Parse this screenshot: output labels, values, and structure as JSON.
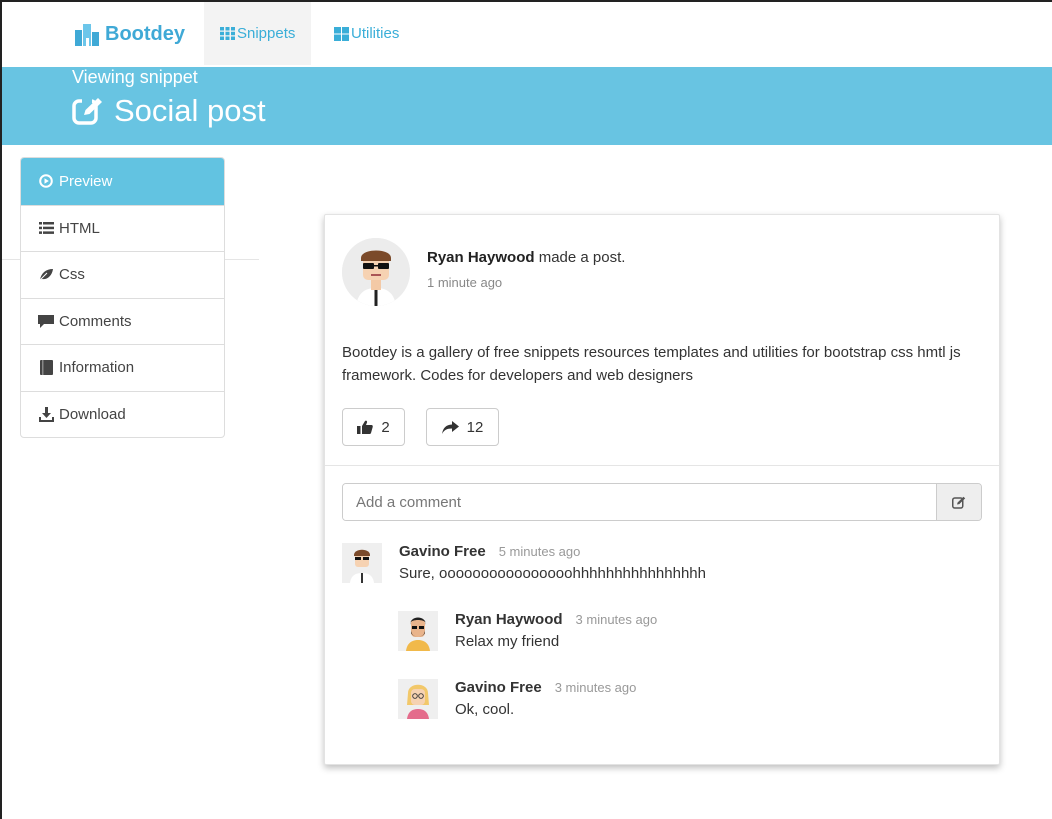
{
  "navbar": {
    "brand": "Bootdey",
    "items": [
      {
        "label": "Snippets",
        "active": true
      },
      {
        "label": "Utilities",
        "active": false
      }
    ]
  },
  "header": {
    "subtitle": "Viewing snippet",
    "title": "Social post"
  },
  "sidebar": {
    "items": [
      {
        "label": "Preview",
        "icon": "play-circle-icon",
        "active": true
      },
      {
        "label": "HTML",
        "icon": "list-icon"
      },
      {
        "label": "Css",
        "icon": "leaf-icon"
      },
      {
        "label": "Comments",
        "icon": "comment-icon"
      },
      {
        "label": "Information",
        "icon": "book-icon"
      },
      {
        "label": "Download",
        "icon": "download-icon"
      }
    ]
  },
  "post": {
    "author": "Ryan Haywood",
    "action": "made a post.",
    "time": "1 minute ago",
    "body": "Bootdey is a gallery of free snippets resources templates and utilities for bootstrap css hmtl js framework. Codes for developers and web designers",
    "likes": "2",
    "shares": "12"
  },
  "comment_form": {
    "placeholder": "Add a comment"
  },
  "comments": [
    {
      "name": "Gavino Free",
      "time": "5 minutes ago",
      "text": "Sure, oooooooooooooooohhhhhhhhhhhhhhhh"
    },
    {
      "name": "Ryan Haywood",
      "time": "3 minutes ago",
      "text": "Relax my friend"
    },
    {
      "name": "Gavino Free",
      "time": "3 minutes ago",
      "text": "Ok, cool."
    }
  ],
  "colors": {
    "accent": "#68c4e2",
    "link": "#3aaed8"
  }
}
